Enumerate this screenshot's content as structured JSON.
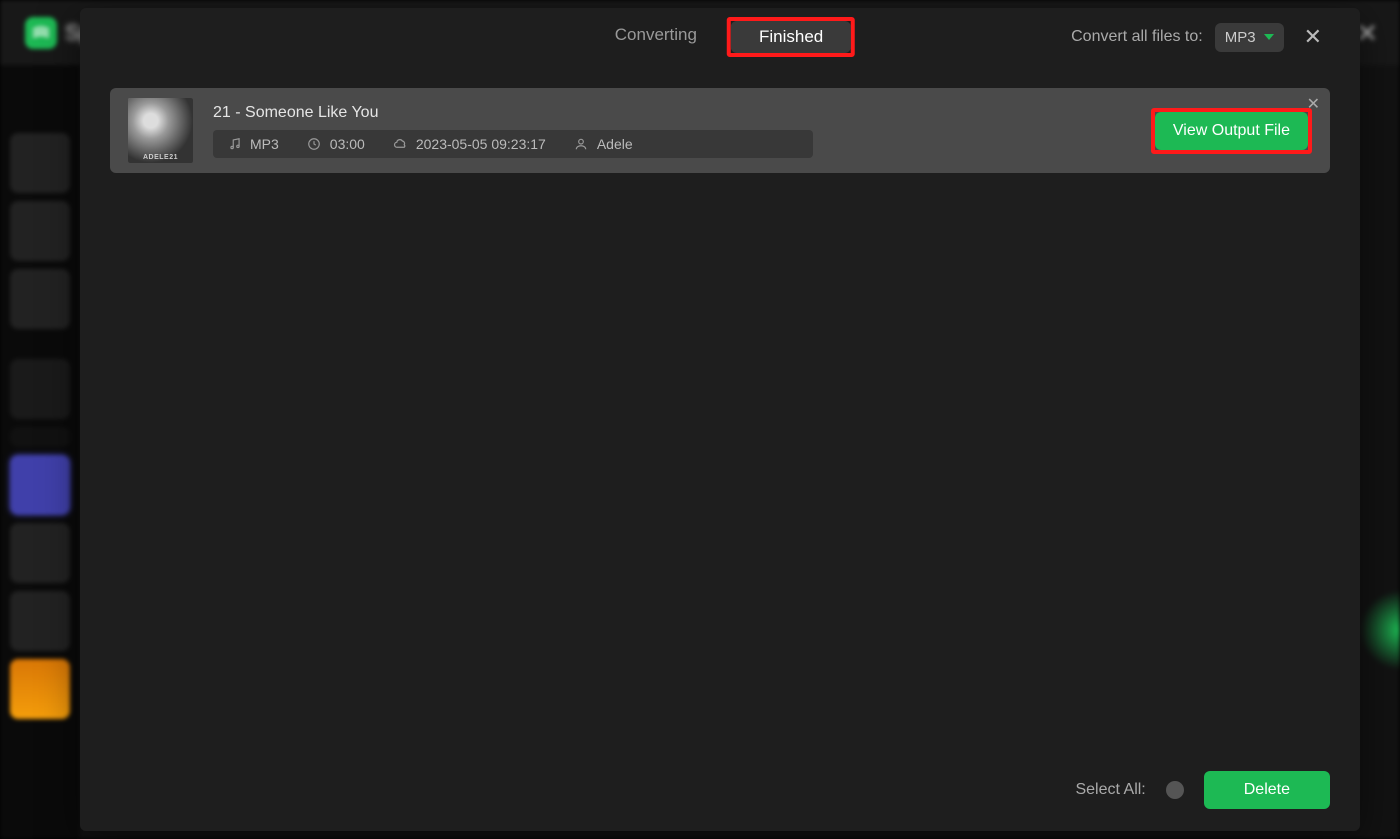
{
  "bg": {
    "app_name": "Sp"
  },
  "header": {
    "tabs": {
      "converting": "Converting",
      "finished": "Finished"
    },
    "convert_all_label": "Convert all files to:",
    "selected_format": "MP3"
  },
  "items": [
    {
      "title": "21 - Someone Like You",
      "format": "MP3",
      "duration": "03:00",
      "timestamp": "2023-05-05 09:23:17",
      "artist": "Adele",
      "view_button": "View Output File"
    }
  ],
  "footer": {
    "select_all_label": "Select All:",
    "delete_label": "Delete"
  }
}
